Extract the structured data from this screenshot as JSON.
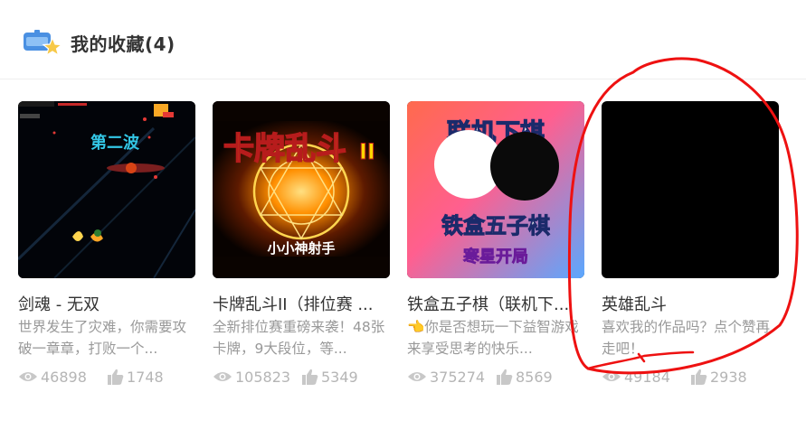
{
  "header": {
    "title": "我的收藏(4)",
    "icon": "favorites-folder-icon"
  },
  "works": [
    {
      "title": "剑魂 - 无双",
      "desc": "世界发生了灾难，你需要攻破一章章，打败一个...",
      "views": "46898",
      "likes": "1748",
      "thumb_text": "第二波"
    },
    {
      "title": "卡牌乱斗II（排位赛 ...",
      "desc": "全新排位赛重磅来袭！48张卡牌，9大段位，等...",
      "views": "105823",
      "likes": "5349",
      "thumb_text": "卡牌乱斗",
      "thumb_sub": "II",
      "thumb_caption": "小小神射手"
    },
    {
      "title": "铁盒五子棋（联机下...",
      "desc": "👈你是否想玩一下益智游戏来享受思考的快乐...",
      "views": "375274",
      "likes": "8569",
      "thumb_text": "联机下棋",
      "thumb_line2": "铁盒五子棋",
      "thumb_line3": "寒星开局"
    },
    {
      "title": "英雄乱斗",
      "desc": "喜欢我的作品吗？点个赞再走吧！",
      "views": "49184",
      "likes": "2938"
    }
  ],
  "colors": {
    "annotation": "#ee1111",
    "stat": "#b5b5b5",
    "accent": "#4a90e2"
  },
  "icons": {
    "views": "eye-icon",
    "likes": "thumbs-up-icon"
  }
}
